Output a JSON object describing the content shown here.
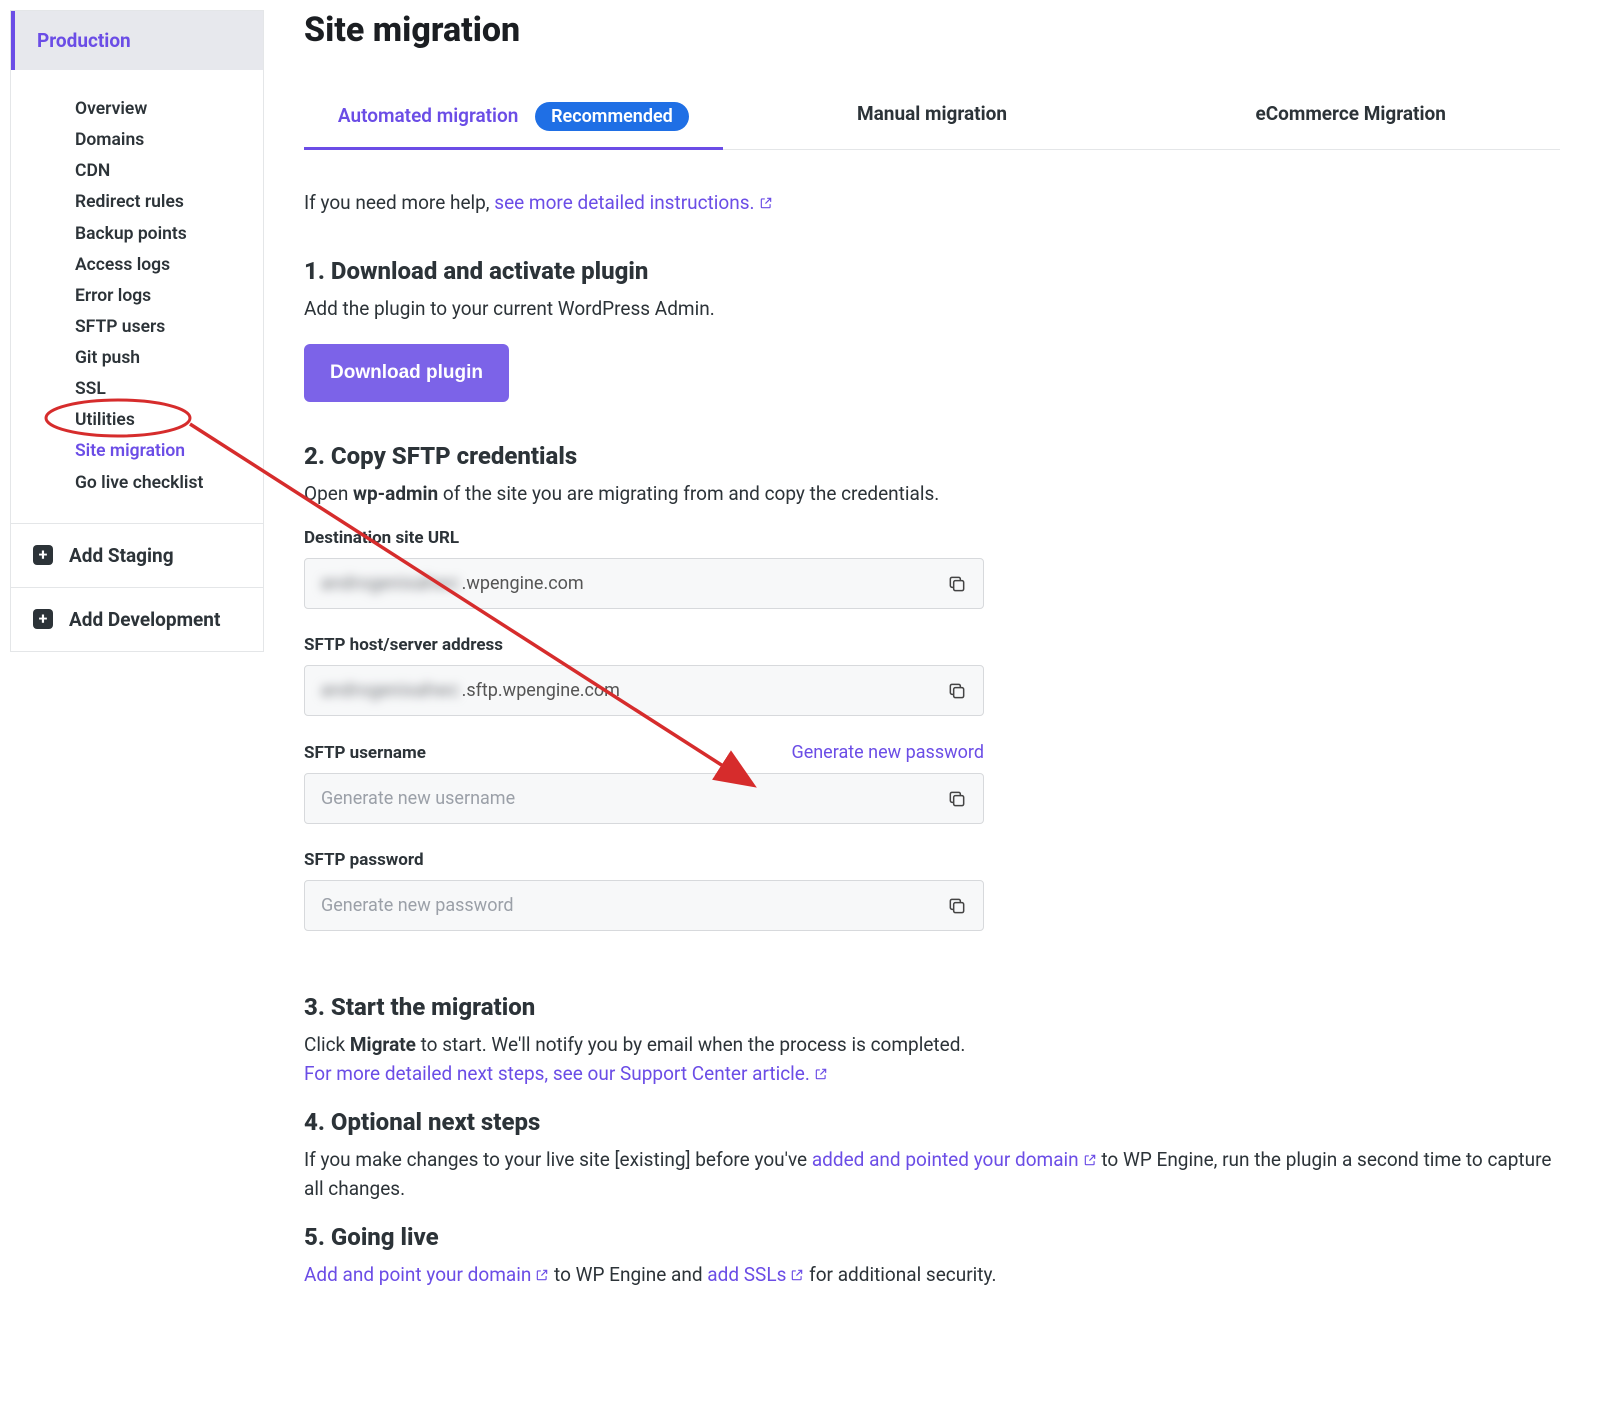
{
  "sidebar": {
    "env_label": "Production",
    "items": [
      {
        "label": "Overview"
      },
      {
        "label": "Domains"
      },
      {
        "label": "CDN"
      },
      {
        "label": "Redirect rules"
      },
      {
        "label": "Backup points"
      },
      {
        "label": "Access logs"
      },
      {
        "label": "Error logs"
      },
      {
        "label": "SFTP users"
      },
      {
        "label": "Git push"
      },
      {
        "label": "SSL"
      },
      {
        "label": "Utilities"
      },
      {
        "label": "Site migration",
        "active": true
      },
      {
        "label": "Go live checklist"
      }
    ],
    "add_staging": "Add Staging",
    "add_development": "Add Development"
  },
  "page": {
    "title": "Site migration",
    "tabs": {
      "auto": "Automated migration",
      "badge": "Recommended",
      "manual": "Manual migration",
      "ecom": "eCommerce Migration"
    },
    "help_prefix": "If you need more help, ",
    "help_link": "see more detailed instructions.",
    "steps": {
      "s1_title": "1. Download and activate plugin",
      "s1_desc": "Add the plugin to your current WordPress Admin.",
      "s1_button": "Download plugin",
      "s2_title": "2. Copy SFTP credentials",
      "s2_desc_pre": "Open ",
      "s2_desc_bold": "wp-admin",
      "s2_desc_post": " of the site you are migrating from and copy the credentials.",
      "dest_label": "Destination site URL",
      "dest_blur": "androgenixahwc",
      "dest_suffix": ".wpengine.com",
      "host_label": "SFTP host/server address",
      "host_blur": "androgenixahwc",
      "host_suffix": ".sftp.wpengine.com",
      "user_label": "SFTP username",
      "user_link": "Generate new password",
      "user_placeholder": "Generate new username",
      "pass_label": "SFTP password",
      "pass_placeholder": "Generate new password",
      "s3_title": "3. Start the migration",
      "s3_pre": "Click ",
      "s3_bold": "Migrate",
      "s3_post": " to start. We'll notify you by email when the process is completed.",
      "s3_link": "For more detailed next steps, see our Support Center article.",
      "s4_title": "4. Optional next steps",
      "s4_pre": "If you make changes to your live site [existing] before you've ",
      "s4_link": "added and pointed your domain",
      "s4_post": " to WP Engine, run the plugin a second time to capture all changes.",
      "s5_title": "5. Going live",
      "s5_link1": "Add and point your domain",
      "s5_mid": " to WP Engine and ",
      "s5_link2": "add SSLs",
      "s5_post": " for additional security."
    }
  }
}
